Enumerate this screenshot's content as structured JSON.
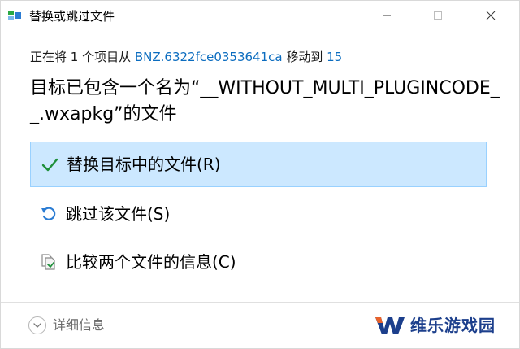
{
  "window": {
    "title": "替换或跳过文件",
    "controls": {
      "minimize_icon": "minimize-icon",
      "maximize_icon": "maximize-icon",
      "close_icon": "close-icon"
    }
  },
  "status": {
    "prefix": "正在将 1 个项目从 ",
    "source": "BNZ.6322fce0353641ca",
    "middle": " 移动到 ",
    "destination": "15"
  },
  "heading": "目标已包含一个名为“__WITHOUT_MULTI_PLUGINCODE__.wxapkg”的文件",
  "options": [
    {
      "label": "替换目标中的文件(R)",
      "icon": "checkmark-icon",
      "selected": true
    },
    {
      "label": "跳过该文件(S)",
      "icon": "undo-arrow-icon",
      "selected": false
    },
    {
      "label": "比较两个文件的信息(C)",
      "icon": "compare-files-icon",
      "selected": false
    }
  ],
  "footer": {
    "details_label": "详细信息",
    "watermark_text": "维乐游戏园"
  },
  "colors": {
    "accent_link": "#0b6cbf",
    "selected_bg": "#cce8ff",
    "selected_border": "#99d1ff",
    "check_green": "#1e8f3a",
    "watermark_blue": "#1c3f8c",
    "watermark_orange": "#e8622a"
  }
}
